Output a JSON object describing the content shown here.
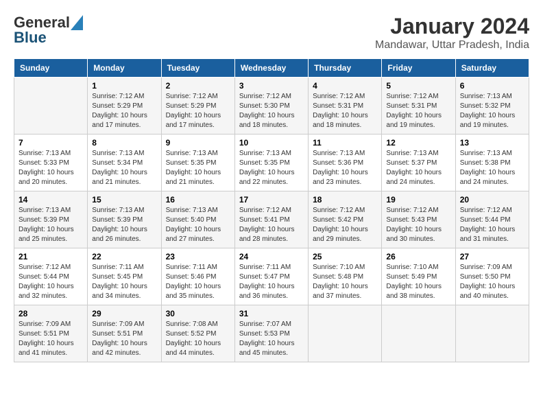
{
  "logo": {
    "text_general": "General",
    "text_blue": "Blue"
  },
  "title": "January 2024",
  "location": "Mandawar, Uttar Pradesh, India",
  "days_of_week": [
    "Sunday",
    "Monday",
    "Tuesday",
    "Wednesday",
    "Thursday",
    "Friday",
    "Saturday"
  ],
  "weeks": [
    [
      {
        "day": "",
        "info": ""
      },
      {
        "day": "1",
        "info": "Sunrise: 7:12 AM\nSunset: 5:29 PM\nDaylight: 10 hours\nand 17 minutes."
      },
      {
        "day": "2",
        "info": "Sunrise: 7:12 AM\nSunset: 5:29 PM\nDaylight: 10 hours\nand 17 minutes."
      },
      {
        "day": "3",
        "info": "Sunrise: 7:12 AM\nSunset: 5:30 PM\nDaylight: 10 hours\nand 18 minutes."
      },
      {
        "day": "4",
        "info": "Sunrise: 7:12 AM\nSunset: 5:31 PM\nDaylight: 10 hours\nand 18 minutes."
      },
      {
        "day": "5",
        "info": "Sunrise: 7:12 AM\nSunset: 5:31 PM\nDaylight: 10 hours\nand 19 minutes."
      },
      {
        "day": "6",
        "info": "Sunrise: 7:13 AM\nSunset: 5:32 PM\nDaylight: 10 hours\nand 19 minutes."
      }
    ],
    [
      {
        "day": "7",
        "info": "Sunrise: 7:13 AM\nSunset: 5:33 PM\nDaylight: 10 hours\nand 20 minutes."
      },
      {
        "day": "8",
        "info": "Sunrise: 7:13 AM\nSunset: 5:34 PM\nDaylight: 10 hours\nand 21 minutes."
      },
      {
        "day": "9",
        "info": "Sunrise: 7:13 AM\nSunset: 5:35 PM\nDaylight: 10 hours\nand 21 minutes."
      },
      {
        "day": "10",
        "info": "Sunrise: 7:13 AM\nSunset: 5:35 PM\nDaylight: 10 hours\nand 22 minutes."
      },
      {
        "day": "11",
        "info": "Sunrise: 7:13 AM\nSunset: 5:36 PM\nDaylight: 10 hours\nand 23 minutes."
      },
      {
        "day": "12",
        "info": "Sunrise: 7:13 AM\nSunset: 5:37 PM\nDaylight: 10 hours\nand 24 minutes."
      },
      {
        "day": "13",
        "info": "Sunrise: 7:13 AM\nSunset: 5:38 PM\nDaylight: 10 hours\nand 24 minutes."
      }
    ],
    [
      {
        "day": "14",
        "info": "Sunrise: 7:13 AM\nSunset: 5:39 PM\nDaylight: 10 hours\nand 25 minutes."
      },
      {
        "day": "15",
        "info": "Sunrise: 7:13 AM\nSunset: 5:39 PM\nDaylight: 10 hours\nand 26 minutes."
      },
      {
        "day": "16",
        "info": "Sunrise: 7:13 AM\nSunset: 5:40 PM\nDaylight: 10 hours\nand 27 minutes."
      },
      {
        "day": "17",
        "info": "Sunrise: 7:12 AM\nSunset: 5:41 PM\nDaylight: 10 hours\nand 28 minutes."
      },
      {
        "day": "18",
        "info": "Sunrise: 7:12 AM\nSunset: 5:42 PM\nDaylight: 10 hours\nand 29 minutes."
      },
      {
        "day": "19",
        "info": "Sunrise: 7:12 AM\nSunset: 5:43 PM\nDaylight: 10 hours\nand 30 minutes."
      },
      {
        "day": "20",
        "info": "Sunrise: 7:12 AM\nSunset: 5:44 PM\nDaylight: 10 hours\nand 31 minutes."
      }
    ],
    [
      {
        "day": "21",
        "info": "Sunrise: 7:12 AM\nSunset: 5:44 PM\nDaylight: 10 hours\nand 32 minutes."
      },
      {
        "day": "22",
        "info": "Sunrise: 7:11 AM\nSunset: 5:45 PM\nDaylight: 10 hours\nand 34 minutes."
      },
      {
        "day": "23",
        "info": "Sunrise: 7:11 AM\nSunset: 5:46 PM\nDaylight: 10 hours\nand 35 minutes."
      },
      {
        "day": "24",
        "info": "Sunrise: 7:11 AM\nSunset: 5:47 PM\nDaylight: 10 hours\nand 36 minutes."
      },
      {
        "day": "25",
        "info": "Sunrise: 7:10 AM\nSunset: 5:48 PM\nDaylight: 10 hours\nand 37 minutes."
      },
      {
        "day": "26",
        "info": "Sunrise: 7:10 AM\nSunset: 5:49 PM\nDaylight: 10 hours\nand 38 minutes."
      },
      {
        "day": "27",
        "info": "Sunrise: 7:09 AM\nSunset: 5:50 PM\nDaylight: 10 hours\nand 40 minutes."
      }
    ],
    [
      {
        "day": "28",
        "info": "Sunrise: 7:09 AM\nSunset: 5:51 PM\nDaylight: 10 hours\nand 41 minutes."
      },
      {
        "day": "29",
        "info": "Sunrise: 7:09 AM\nSunset: 5:51 PM\nDaylight: 10 hours\nand 42 minutes."
      },
      {
        "day": "30",
        "info": "Sunrise: 7:08 AM\nSunset: 5:52 PM\nDaylight: 10 hours\nand 44 minutes."
      },
      {
        "day": "31",
        "info": "Sunrise: 7:07 AM\nSunset: 5:53 PM\nDaylight: 10 hours\nand 45 minutes."
      },
      {
        "day": "",
        "info": ""
      },
      {
        "day": "",
        "info": ""
      },
      {
        "day": "",
        "info": ""
      }
    ]
  ]
}
